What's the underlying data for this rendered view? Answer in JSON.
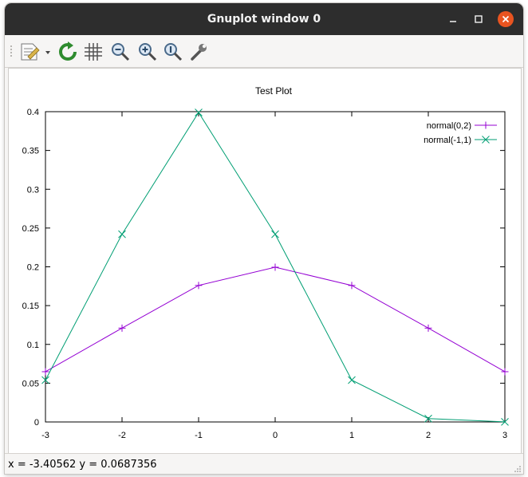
{
  "window": {
    "title": "Gnuplot window 0"
  },
  "toolbar": {
    "buttons": [
      {
        "name": "copy-to-clipboard",
        "icon": "clipboard-icon"
      },
      {
        "name": "replot",
        "icon": "refresh-icon"
      },
      {
        "name": "toggle-grid",
        "icon": "grid-icon"
      },
      {
        "name": "zoom-out",
        "icon": "zoom-out-icon"
      },
      {
        "name": "zoom-in",
        "icon": "zoom-in-icon"
      },
      {
        "name": "zoom-fit",
        "icon": "zoom-fit-icon"
      },
      {
        "name": "settings",
        "icon": "wrench-icon"
      }
    ]
  },
  "status": {
    "text": "x = -3.40562 y = 0.0687356"
  },
  "chart_data": {
    "type": "line",
    "title": "Test Plot",
    "xlabel": "",
    "ylabel": "",
    "x": [
      -3,
      -2,
      -1,
      0,
      1,
      2,
      3
    ],
    "xlim": [
      -3,
      3
    ],
    "ylim": [
      0,
      0.4
    ],
    "xticks": [
      "-3",
      "-2",
      "-1",
      "0",
      "1",
      "2",
      "3"
    ],
    "yticks": [
      "0",
      "0.05",
      "0.1",
      "0.15",
      "0.2",
      "0.25",
      "0.3",
      "0.35",
      "0.4"
    ],
    "grid": false,
    "legend_position": "top-right",
    "series": [
      {
        "name": "normal(0,2)",
        "color": "#9400d3",
        "marker": "plus",
        "values": [
          0.0648,
          0.121,
          0.176,
          0.1995,
          0.176,
          0.121,
          0.0648
        ]
      },
      {
        "name": "normal(-1,1)",
        "color": "#009e73",
        "marker": "cross",
        "values": [
          0.054,
          0.242,
          0.399,
          0.242,
          0.054,
          0.0044,
          0.0001
        ]
      }
    ]
  }
}
